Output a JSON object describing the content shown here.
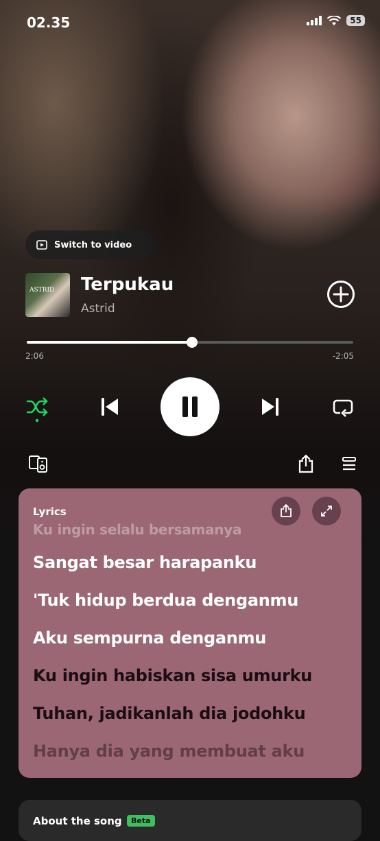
{
  "status": {
    "time": "02.35",
    "battery": "55"
  },
  "video": {
    "switch_label": "Switch to video"
  },
  "track": {
    "title": "Terpukau",
    "artist": "Astrid",
    "album_art_text": "ASTRID"
  },
  "playback": {
    "elapsed": "2:06",
    "remaining": "-2:05",
    "progress": 0.506
  },
  "lyrics": {
    "label": "Lyrics",
    "lines": [
      {
        "text": "Ku ingin selalu bersamanya",
        "state": "fade-top"
      },
      {
        "text": "Sangat besar harapanku",
        "state": "past"
      },
      {
        "text": "'Tuk hidup berdua denganmu",
        "state": "past"
      },
      {
        "text": "Aku sempurna denganmu",
        "state": "past"
      },
      {
        "text": "Ku ingin habiskan sisa umurku",
        "state": "future"
      },
      {
        "text": "Tuhan, jadikanlah dia jodohku",
        "state": "future"
      },
      {
        "text": "Hanya dia yang membuat aku",
        "state": "fade-bottom"
      }
    ]
  },
  "about": {
    "title": "About the song",
    "badge": "Beta"
  },
  "colors": {
    "accent": "#1ed760",
    "lyrics_card": "#9b6775"
  }
}
